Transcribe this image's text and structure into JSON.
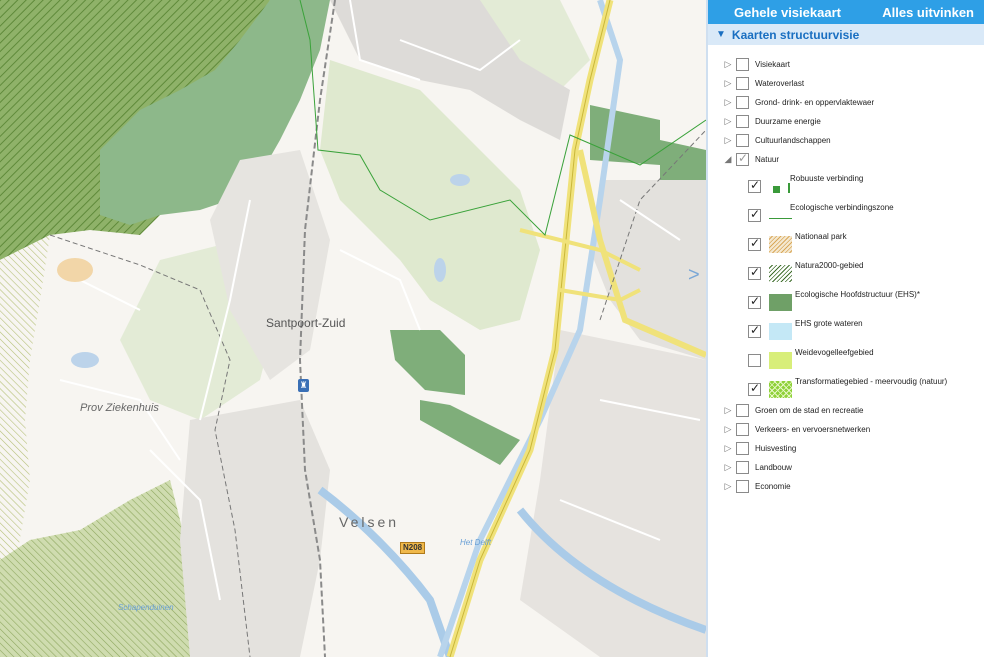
{
  "map": {
    "labels": {
      "santpoort": "Santpoort-Zuid",
      "velsen": "Velsen",
      "ziekenhuis": "Prov Ziekenhuis",
      "delft": "Het Delft",
      "schapenduinen": "Schapenduinen",
      "n208": "N208"
    }
  },
  "panel": {
    "topbar": {
      "map_label": "Gehele visiekaart",
      "uncheck_label": "Alles uitvinken"
    },
    "section": {
      "title": "Kaarten structuurvisie"
    },
    "layers": [
      {
        "label": "Visiekaart",
        "checked": false,
        "expanded": false
      },
      {
        "label": "Wateroverlast",
        "checked": false,
        "expanded": false
      },
      {
        "label": "Grond- drink- en oppervlaktewaer",
        "checked": false,
        "expanded": false
      },
      {
        "label": "Duurzame energie",
        "checked": false,
        "expanded": false
      },
      {
        "label": "Cultuurlandschappen",
        "checked": false,
        "expanded": false
      },
      {
        "label": "Natuur",
        "checked": true,
        "expanded": true
      },
      {
        "label": "Groen om de stad en recreatie",
        "checked": false,
        "expanded": false
      },
      {
        "label": "Verkeers- en vervoersnetwerken",
        "checked": false,
        "expanded": false
      },
      {
        "label": "Huisvesting",
        "checked": false,
        "expanded": false
      },
      {
        "label": "Landbouw",
        "checked": false,
        "expanded": false
      },
      {
        "label": "Economie",
        "checked": false,
        "expanded": false
      }
    ],
    "natuur_sublayers": [
      {
        "label": "Robuuste verbinding",
        "checked": true,
        "legend": "robuust"
      },
      {
        "label": "Ecologische verbindingszone",
        "checked": true,
        "legend": "line-green"
      },
      {
        "label": "Nationaal park",
        "checked": true,
        "legend": "hatch-orange"
      },
      {
        "label": "Natura2000-gebied",
        "checked": true,
        "legend": "hatch-green"
      },
      {
        "label": "Ecologische Hoofdstructuur (EHS)*",
        "checked": true,
        "legend": "solid-green"
      },
      {
        "label": "EHS grote wateren",
        "checked": true,
        "legend": "light-blue"
      },
      {
        "label": "Weidevogelleefgebied",
        "checked": false,
        "legend": "lime"
      },
      {
        "label": "Transformatiegebied - meervoudig (natuur)",
        "checked": true,
        "legend": "cross-green"
      }
    ],
    "colors": {
      "topbar": "#2e9fe6",
      "section_bg": "#d9e9f8",
      "accent": "#1a6fc1"
    }
  }
}
